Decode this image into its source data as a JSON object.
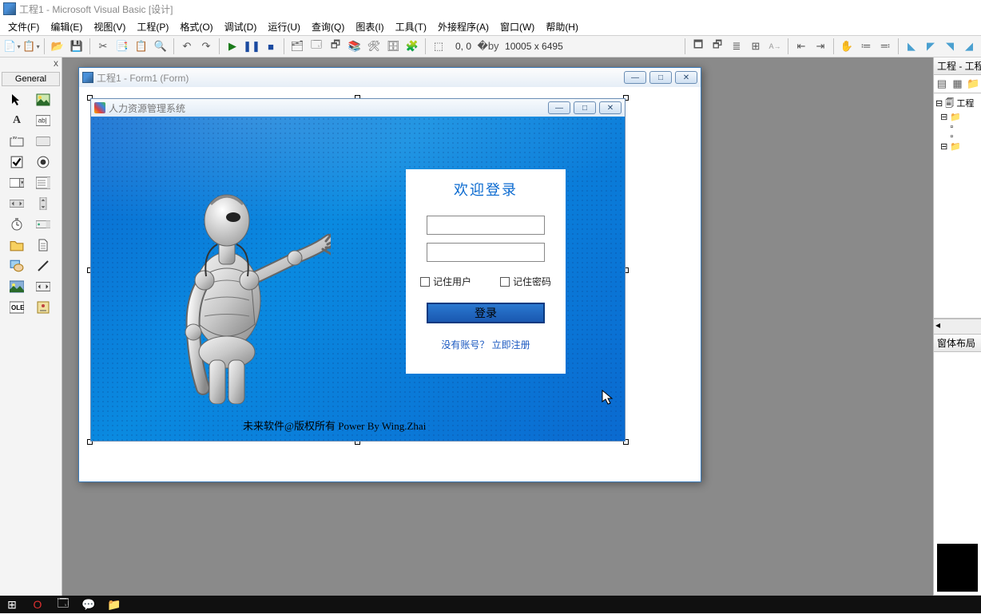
{
  "app": {
    "title": "工程1 - Microsoft Visual Basic [设计]"
  },
  "menu": {
    "file": "文件(F)",
    "edit": "编辑(E)",
    "view": "视图(V)",
    "project": "工程(P)",
    "format": "格式(O)",
    "debug": "调试(D)",
    "run": "运行(U)",
    "query": "查询(Q)",
    "diagram": "图表(I)",
    "tools": "工具(T)",
    "addins": "外接程序(A)",
    "window": "窗口(W)",
    "help": "帮助(H)"
  },
  "toolbar": {
    "pos": "0, 0",
    "size": "10005 x 6495"
  },
  "toolbox": {
    "close": "x",
    "tab": "General"
  },
  "form": {
    "title": "工程1 - Form1 (Form)"
  },
  "inner": {
    "title": "人力资源管理系统",
    "footer": "未来软件@版权所有  Power By Wing.Zhai"
  },
  "login": {
    "title": "欢迎登录",
    "remember_user": "记住用户",
    "remember_pwd": "记住密码",
    "button": "登录",
    "no_account": "没有账号？",
    "register": "立即注册"
  },
  "panels": {
    "project": "工程 - 工程",
    "project_root": "工程",
    "layout": "窗体布局"
  }
}
